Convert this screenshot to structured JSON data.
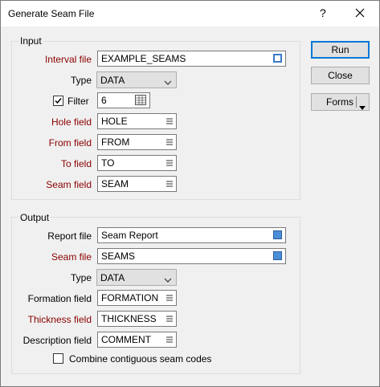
{
  "window": {
    "title": "Generate Seam File",
    "help_label": "?"
  },
  "buttons": {
    "run": "Run",
    "close": "Close",
    "forms": "Forms"
  },
  "input": {
    "group_label": "Input",
    "interval_file": {
      "label": "Interval file",
      "value": "EXAMPLE_SEAMS"
    },
    "type": {
      "label": "Type",
      "value": "DATA"
    },
    "filter": {
      "label": "Filter",
      "checked": true,
      "value": "6"
    },
    "hole_field": {
      "label": "Hole field",
      "value": "HOLE"
    },
    "from_field": {
      "label": "From field",
      "value": "FROM"
    },
    "to_field": {
      "label": "To field",
      "value": "TO"
    },
    "seam_field": {
      "label": "Seam field",
      "value": "SEAM"
    }
  },
  "output": {
    "group_label": "Output",
    "report_file": {
      "label": "Report file",
      "value": "Seam Report"
    },
    "seam_file": {
      "label": "Seam file",
      "value": "SEAMS"
    },
    "type": {
      "label": "Type",
      "value": "DATA"
    },
    "formation_field": {
      "label": "Formation field",
      "value": "FORMATION"
    },
    "thickness_field": {
      "label": "Thickness field",
      "value": "THICKNESS"
    },
    "description_field": {
      "label": "Description field",
      "value": "COMMENT"
    },
    "combine": {
      "label": "Combine contiguous seam codes",
      "checked": false
    }
  },
  "colors": {
    "required_label": "#8b0000",
    "accent": "#0078d7"
  },
  "icons": {
    "list": "list-icon",
    "file": "file-icon",
    "close": "close-icon",
    "dropdown": "chevron-down-icon",
    "table": "table-icon"
  }
}
